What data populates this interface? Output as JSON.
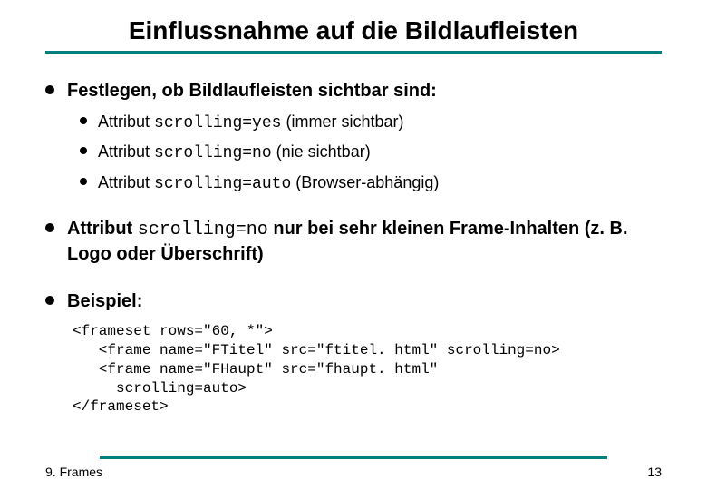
{
  "title": "Einflussnahme auf die Bildlaufleisten",
  "bullets": {
    "b1": {
      "text": "Festlegen, ob Bildlaufleisten sichtbar sind:"
    },
    "b1sub": {
      "s1": {
        "prefix": "Attribut ",
        "code": "scrolling=yes",
        "suffix": " (immer sichtbar)"
      },
      "s2": {
        "prefix": "Attribut ",
        "code": "scrolling=no",
        "suffix": " (nie sichtbar)"
      },
      "s3": {
        "prefix": "Attribut ",
        "code": "scrolling=auto",
        "suffix": " (Browser-abhängig)"
      }
    },
    "b2": {
      "prefix": "Attribut ",
      "code": "scrolling=no",
      "suffix": " nur bei sehr kleinen Frame-Inhalten (z. B. Logo oder Überschrift)"
    },
    "b3": {
      "text": "Beispiel:"
    }
  },
  "code": "<frameset rows=\"60, *\">\n   <frame name=\"FTitel\" src=\"ftitel. html\" scrolling=no>\n   <frame name=\"FHaupt\" src=\"fhaupt. html\"\n     scrolling=auto>\n</frameset>",
  "footer": {
    "left": "9. Frames",
    "right": "13"
  }
}
